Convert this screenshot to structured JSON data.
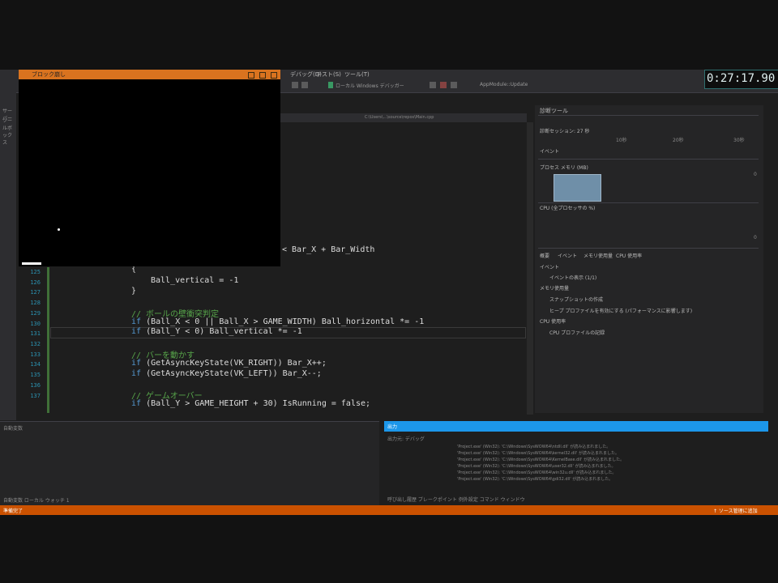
{
  "ide": {
    "menu_items": [
      "デバッグ(D)",
      "テスト(S)",
      "ツール(T)"
    ],
    "toolbar_items": [
      "ローカル Windows デバッガー",
      "AppModule::Update"
    ],
    "left_strip_labels": [
      "サーバー",
      "ツールボックス"
    ],
    "editor_tab_path": "C:\\Users\\...\\source\\repos\\Main.cpp"
  },
  "game_window": {
    "title": "ブロック崩し"
  },
  "timer": {
    "value": "0:27:17.90"
  },
  "code": {
    "line_numbers": [
      "125",
      "126",
      "127",
      "128",
      "129",
      "130",
      "131",
      "132",
      "133",
      "134",
      "135",
      "136",
      "137"
    ],
    "line_top": "< Bar_X + Bar_Width",
    "line_a": "{",
    "line_b": "Ball_vertical = -1",
    "line_c": "}",
    "cm1": "// ボールの壁衝突判定",
    "if1_kw": "if",
    "if1_rest": "(Ball_X < 0 || Ball_X > GAME_WIDTH) Ball_horizontal *= -1",
    "if2_kw": "if",
    "if2_rest": "(Ball_Y < 0) Ball_vertical *= -1",
    "cm2": "// バーを動かす",
    "if3_kw": "if",
    "if3_rest": "(GetAsyncKeyState(VK_RIGHT)) Bar_X++;",
    "if4_kw": "if",
    "if4_rest": "(GetAsyncKeyState(VK_LEFT)) Bar_X--;",
    "cm3": "// ゲームオーバー",
    "if5_kw": "if",
    "if5_rest": "(Ball_Y > GAME_HEIGHT + 30) IsRunning = false;"
  },
  "diagnostics": {
    "title": "診断ツール",
    "session_label": "診断セッション: 27 秒",
    "events_label": "イベント",
    "cpu_label": "プロセス メモリ (MB)",
    "cpu2_label": "CPU (全プロセッサの %)",
    "tabs": [
      "概要",
      "イベント",
      "メモリ使用量",
      "CPU 使用率"
    ],
    "section_events": "イベント",
    "events_item": "イベントの表示 (1/1)",
    "section_memory": "メモリ使用量",
    "memory_item_1": "スナップショットの作成",
    "memory_item_2": "ヒープ プロファイルを有効にする (パフォーマンスに影響します)",
    "section_cpu": "CPU 使用率",
    "cpu_item": "CPU プロファイルの記録",
    "scale": [
      "10秒",
      "20秒",
      "30秒"
    ],
    "chart_value_top": "0",
    "chart_value_bottom": "0"
  },
  "bottom": {
    "left_title": "自動変数",
    "output_title": "出力",
    "output_source_label": "出力元: デバッグ",
    "output_lines": [
      "'Project.exe' (Win32): 'C:\\Windows\\SysWOW64\\ntdll.dll' が読み込まれました。",
      "'Project.exe' (Win32): 'C:\\Windows\\SysWOW64\\kernel32.dll' が読み込まれました。",
      "'Project.exe' (Win32): 'C:\\Windows\\SysWOW64\\KernelBase.dll' が読み込まれました。",
      "'Project.exe' (Win32): 'C:\\Windows\\SysWOW64\\user32.dll' が読み込まれました。",
      "'Project.exe' (Win32): 'C:\\Windows\\SysWOW64\\win32u.dll' が読み込まれました。",
      "'Project.exe' (Win32): 'C:\\Windows\\SysWOW64\\gdi32.dll' が読み込まれました。"
    ],
    "output_tabs": "呼び出し履歴  ブレークポイント  例外設定  コマンド ウィンドウ",
    "left_tabs": "自動変数  ローカル  ウォッチ 1"
  },
  "status": {
    "left": "準備完了",
    "right": "↑ ソース管理に追加"
  },
  "colors": {
    "title_accent": "#d9731f",
    "status_bar": "#ca5100",
    "output_header": "#1c97ea"
  }
}
